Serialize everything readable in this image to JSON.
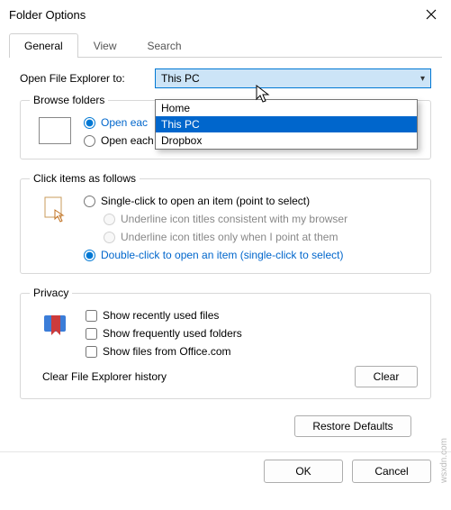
{
  "window": {
    "title": "Folder Options"
  },
  "tabs": {
    "general": "General",
    "view": "View",
    "search": "Search"
  },
  "open_explorer": {
    "label": "Open File Explorer to:",
    "value": "This PC",
    "options": [
      "Home",
      "This PC",
      "Dropbox"
    ],
    "selected_index": 1
  },
  "browse": {
    "legend": "Browse folders",
    "same": "Open each folder in the same window",
    "same_visible": "Open eac",
    "own": "Open each folder in its own window"
  },
  "click": {
    "legend": "Click items as follows",
    "single": "Single-click to open an item (point to select)",
    "underline_browser": "Underline icon titles consistent with my browser",
    "underline_point": "Underline icon titles only when I point at them",
    "double": "Double-click to open an item (single-click to select)"
  },
  "privacy": {
    "legend": "Privacy",
    "recent": "Show recently used files",
    "frequent": "Show frequently used folders",
    "office": "Show files from Office.com",
    "history": "Clear File Explorer history",
    "clear": "Clear"
  },
  "buttons": {
    "restore": "Restore Defaults",
    "ok": "OK",
    "cancel": "Cancel"
  },
  "watermark": "wsxdn.com"
}
